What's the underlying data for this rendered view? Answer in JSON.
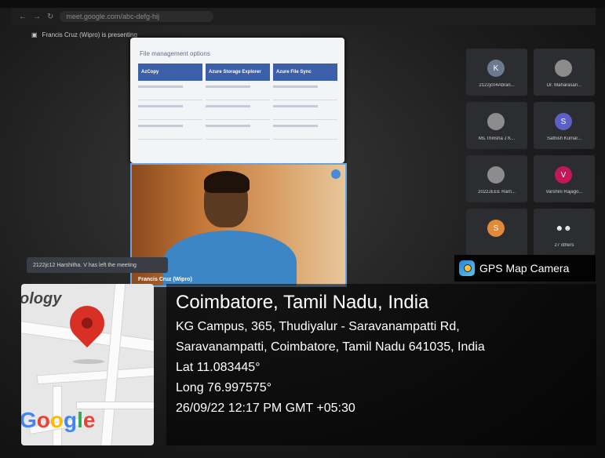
{
  "browser": {
    "url": "meet.google.com/abc-defg-hij"
  },
  "meet": {
    "presenting": "Francis Cruz (Wipro) is presenting",
    "slide_title": "File management options",
    "slide_columns": [
      "AzCopy",
      "Azure Storage Explorer",
      "Azure File Sync"
    ],
    "video_name": "Francis Cruz (Wipro)",
    "left_toast": "2122jc12 Harshitha. V has left the meeting",
    "participants": [
      {
        "initial": "K",
        "name": "2122jc04Abran...",
        "color": "#6b7a8f"
      },
      {
        "initial": "",
        "name": "Dr. Maharasan...",
        "color": "#8c8c8c"
      },
      {
        "initial": "",
        "name": "Ms.Thirisha J K...",
        "color": "#8c8c8c"
      },
      {
        "initial": "S",
        "name": "Sathish Kumar...",
        "color": "#5c5fc4"
      },
      {
        "initial": "",
        "name": "2022JEEE Ram...",
        "color": "#8c8c8c"
      },
      {
        "initial": "V",
        "name": "Varshini Rajago...",
        "color": "#c2185b"
      },
      {
        "initial": "S",
        "name": "",
        "color": "#e08a3a"
      },
      {
        "initial": "",
        "name": "27 others",
        "color": "#2b2d30"
      }
    ]
  },
  "overlay": {
    "app_name": "GPS Map Camera",
    "map_label": "ology",
    "google_letters": [
      "G",
      "o",
      "o",
      "g",
      "l",
      "e"
    ],
    "city": "Coimbatore, Tamil Nadu, India",
    "address_line1": "KG Campus, 365, Thudiyalur - Saravanampatti Rd,",
    "address_line2": "Saravanampatti, Coimbatore, Tamil Nadu 641035, India",
    "lat": "Lat 11.083445°",
    "long": "Long 76.997575°",
    "datetime": "26/09/22 12:17 PM GMT +05:30"
  }
}
